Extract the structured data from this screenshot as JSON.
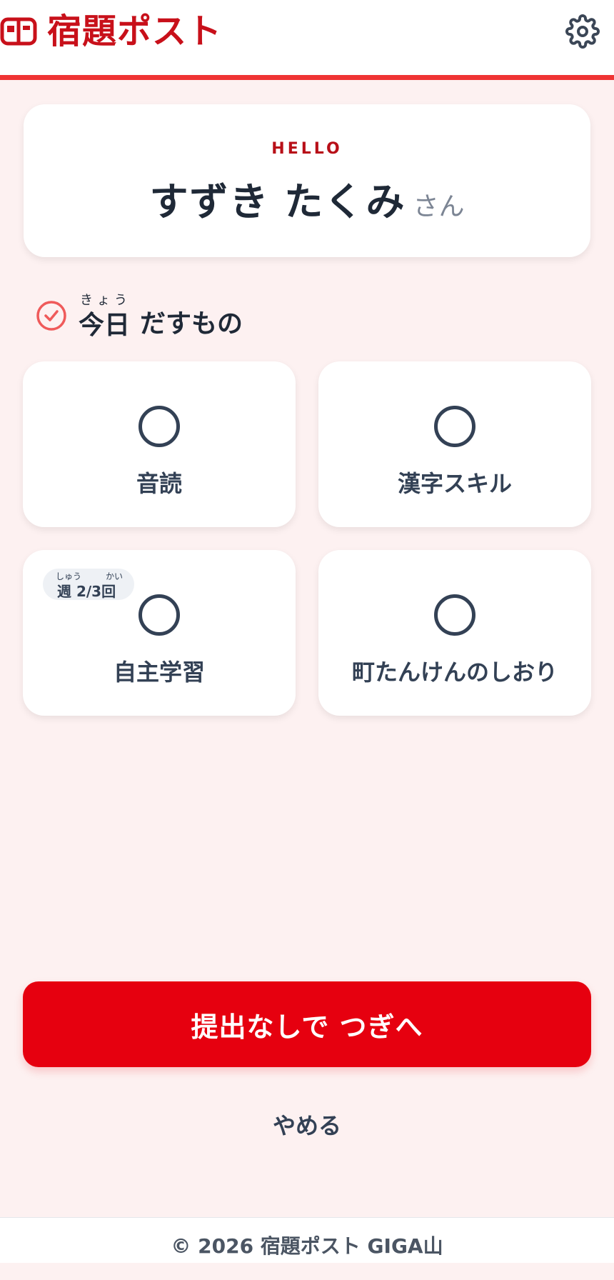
{
  "header": {
    "title": "宿題ポスト",
    "logo_icon": "mailbox-icon",
    "settings_icon": "gear-icon"
  },
  "greeting": {
    "hello": "HELLO",
    "name": "すずき たくみ",
    "honorific": "さん"
  },
  "section": {
    "icon": "check-circle-icon",
    "ruby": "きょう",
    "today": "今日",
    "title": "だすもの"
  },
  "items": [
    {
      "label": "音読",
      "status_icon": "empty-circle-icon"
    },
    {
      "label": "漢字スキル",
      "status_icon": "empty-circle-icon"
    },
    {
      "label": "自主学習",
      "status_icon": "empty-circle-icon",
      "badge": {
        "ruby_week": "しゅう",
        "ruby_times": "かい",
        "text": "週 2/3回"
      }
    },
    {
      "label": "町たんけんのしおり",
      "status_icon": "empty-circle-icon"
    }
  ],
  "actions": {
    "primary": "提出なしで つぎへ",
    "cancel": "やめる"
  },
  "footer": {
    "text": "© 2026 宿題ポスト GIGA山"
  },
  "colors": {
    "brand": "#c8101a",
    "accent_line": "#ef3333",
    "primary_button": "#e6000f",
    "background": "#fdf1f1"
  }
}
